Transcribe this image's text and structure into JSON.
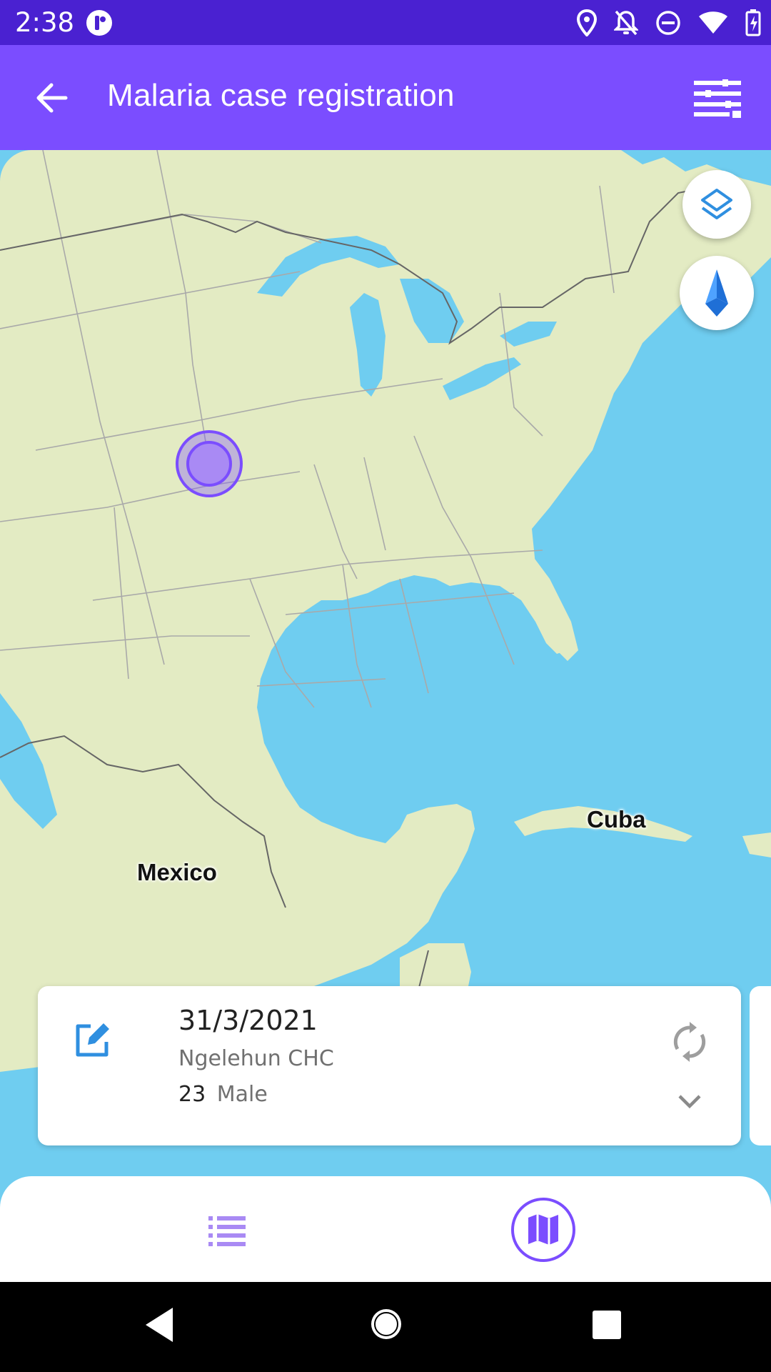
{
  "status_bar": {
    "time": "2:38",
    "icons": [
      "app-notification-icon",
      "location-icon",
      "notifications-off-icon",
      "do-not-disturb-icon",
      "wifi-icon",
      "battery-charging-icon"
    ]
  },
  "app_bar": {
    "title": "Malaria case registration",
    "back_icon": "arrow-back-icon",
    "filter_icon": "filter-icon"
  },
  "map": {
    "labels": {
      "mexico": "Mexico",
      "cuba": "Cuba"
    },
    "controls": [
      "layers-icon",
      "compass-icon",
      "navigation-icon"
    ],
    "colors": {
      "water": "#6fcdf0",
      "land": "#e3ebc3",
      "marker": "#7b4dff"
    }
  },
  "case_card": {
    "date": "31/3/2021",
    "org_unit": "Ngelehun CHC",
    "age": "23",
    "sex": "Male",
    "icons": [
      "edit-icon",
      "sync-icon",
      "chevron-down-icon"
    ]
  },
  "bottom_nav": {
    "items": [
      {
        "name": "list-view",
        "icon": "list-icon",
        "selected": false
      },
      {
        "name": "map-view",
        "icon": "map-icon",
        "selected": true
      }
    ]
  },
  "system_nav": {
    "buttons": [
      "back",
      "home",
      "recents"
    ]
  },
  "theme": {
    "primary": "#7b4dff",
    "status_bar": "#4a21d1",
    "accent_blue": "#2f8fe0"
  }
}
